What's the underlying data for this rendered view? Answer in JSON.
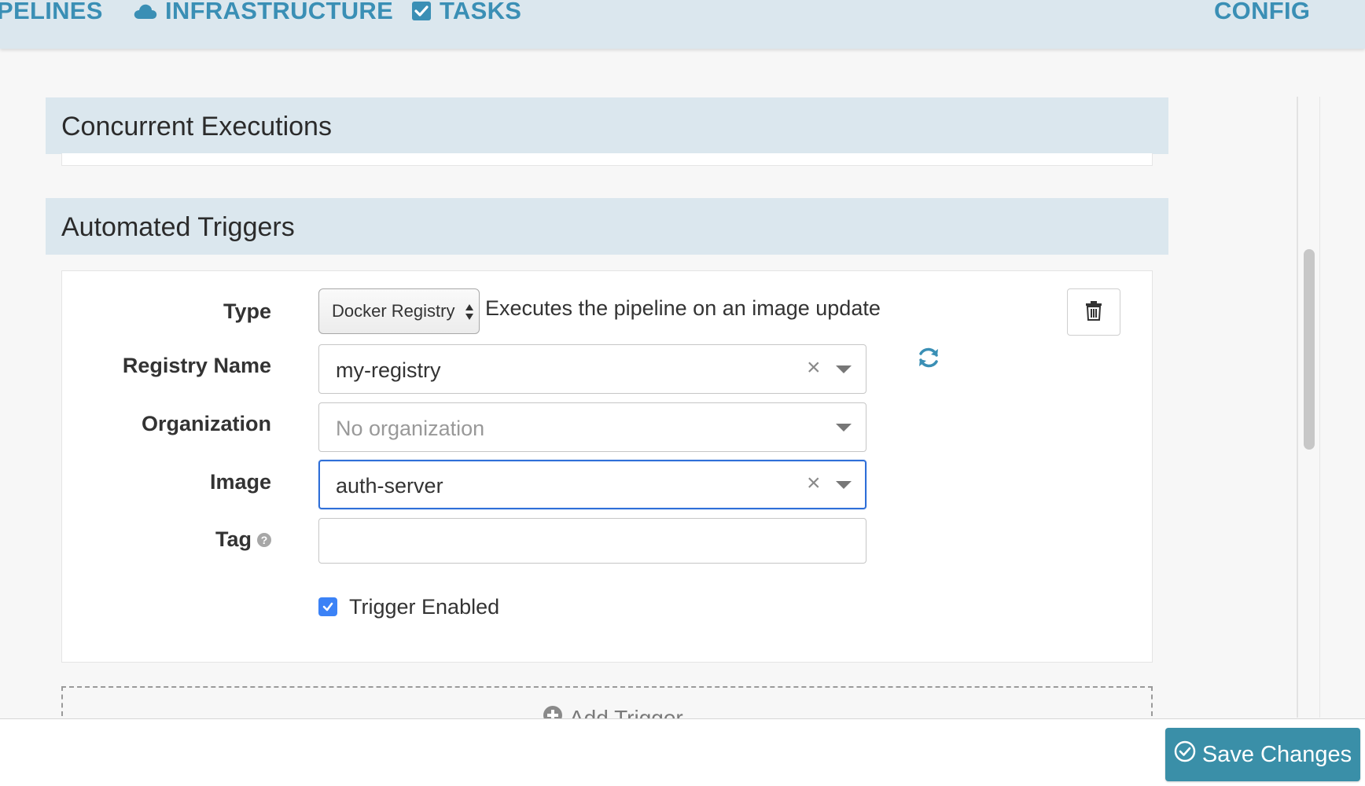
{
  "nav": {
    "items": [
      {
        "label": "PELINES",
        "icon": ""
      },
      {
        "label": "INFRASTRUCTURE",
        "icon": "cloud-icon"
      },
      {
        "label": "TASKS",
        "icon": "check-square-icon"
      },
      {
        "label": "CONFIG",
        "icon": ""
      }
    ],
    "accent_color": "#3a8fb5"
  },
  "sections": {
    "concurrent": {
      "title": "Concurrent Executions"
    },
    "triggers": {
      "title": "Automated Triggers"
    }
  },
  "trigger": {
    "type_label": "Type",
    "type_value": "Docker Registry",
    "type_description": "Executes the pipeline on an image update",
    "registry_label": "Registry Name",
    "registry_value": "my-registry",
    "organization_label": "Organization",
    "organization_placeholder": "No organization",
    "image_label": "Image",
    "image_value": "auth-server",
    "tag_label": "Tag",
    "tag_value": "",
    "enabled_label": "Trigger Enabled",
    "enabled": true,
    "clear_glyph": "×"
  },
  "add_trigger": {
    "label": "Add Trigger"
  },
  "footer": {
    "save_label": "Save Changes",
    "save_color": "#3a8fa8"
  }
}
